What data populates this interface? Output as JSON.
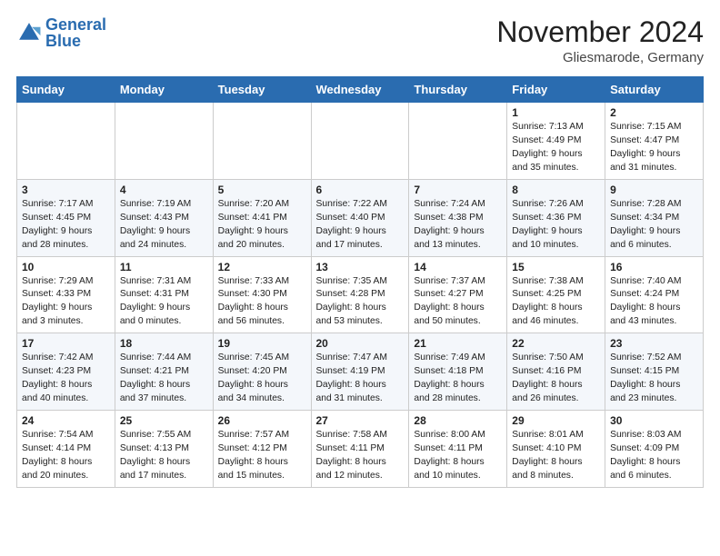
{
  "header": {
    "logo_line1": "General",
    "logo_line2": "Blue",
    "month_title": "November 2024",
    "location": "Gliesmarode, Germany"
  },
  "days_of_week": [
    "Sunday",
    "Monday",
    "Tuesday",
    "Wednesday",
    "Thursday",
    "Friday",
    "Saturday"
  ],
  "weeks": [
    [
      {
        "day": "",
        "info": ""
      },
      {
        "day": "",
        "info": ""
      },
      {
        "day": "",
        "info": ""
      },
      {
        "day": "",
        "info": ""
      },
      {
        "day": "",
        "info": ""
      },
      {
        "day": "1",
        "info": "Sunrise: 7:13 AM\nSunset: 4:49 PM\nDaylight: 9 hours and 35 minutes."
      },
      {
        "day": "2",
        "info": "Sunrise: 7:15 AM\nSunset: 4:47 PM\nDaylight: 9 hours and 31 minutes."
      }
    ],
    [
      {
        "day": "3",
        "info": "Sunrise: 7:17 AM\nSunset: 4:45 PM\nDaylight: 9 hours and 28 minutes."
      },
      {
        "day": "4",
        "info": "Sunrise: 7:19 AM\nSunset: 4:43 PM\nDaylight: 9 hours and 24 minutes."
      },
      {
        "day": "5",
        "info": "Sunrise: 7:20 AM\nSunset: 4:41 PM\nDaylight: 9 hours and 20 minutes."
      },
      {
        "day": "6",
        "info": "Sunrise: 7:22 AM\nSunset: 4:40 PM\nDaylight: 9 hours and 17 minutes."
      },
      {
        "day": "7",
        "info": "Sunrise: 7:24 AM\nSunset: 4:38 PM\nDaylight: 9 hours and 13 minutes."
      },
      {
        "day": "8",
        "info": "Sunrise: 7:26 AM\nSunset: 4:36 PM\nDaylight: 9 hours and 10 minutes."
      },
      {
        "day": "9",
        "info": "Sunrise: 7:28 AM\nSunset: 4:34 PM\nDaylight: 9 hours and 6 minutes."
      }
    ],
    [
      {
        "day": "10",
        "info": "Sunrise: 7:29 AM\nSunset: 4:33 PM\nDaylight: 9 hours and 3 minutes."
      },
      {
        "day": "11",
        "info": "Sunrise: 7:31 AM\nSunset: 4:31 PM\nDaylight: 9 hours and 0 minutes."
      },
      {
        "day": "12",
        "info": "Sunrise: 7:33 AM\nSunset: 4:30 PM\nDaylight: 8 hours and 56 minutes."
      },
      {
        "day": "13",
        "info": "Sunrise: 7:35 AM\nSunset: 4:28 PM\nDaylight: 8 hours and 53 minutes."
      },
      {
        "day": "14",
        "info": "Sunrise: 7:37 AM\nSunset: 4:27 PM\nDaylight: 8 hours and 50 minutes."
      },
      {
        "day": "15",
        "info": "Sunrise: 7:38 AM\nSunset: 4:25 PM\nDaylight: 8 hours and 46 minutes."
      },
      {
        "day": "16",
        "info": "Sunrise: 7:40 AM\nSunset: 4:24 PM\nDaylight: 8 hours and 43 minutes."
      }
    ],
    [
      {
        "day": "17",
        "info": "Sunrise: 7:42 AM\nSunset: 4:23 PM\nDaylight: 8 hours and 40 minutes."
      },
      {
        "day": "18",
        "info": "Sunrise: 7:44 AM\nSunset: 4:21 PM\nDaylight: 8 hours and 37 minutes."
      },
      {
        "day": "19",
        "info": "Sunrise: 7:45 AM\nSunset: 4:20 PM\nDaylight: 8 hours and 34 minutes."
      },
      {
        "day": "20",
        "info": "Sunrise: 7:47 AM\nSunset: 4:19 PM\nDaylight: 8 hours and 31 minutes."
      },
      {
        "day": "21",
        "info": "Sunrise: 7:49 AM\nSunset: 4:18 PM\nDaylight: 8 hours and 28 minutes."
      },
      {
        "day": "22",
        "info": "Sunrise: 7:50 AM\nSunset: 4:16 PM\nDaylight: 8 hours and 26 minutes."
      },
      {
        "day": "23",
        "info": "Sunrise: 7:52 AM\nSunset: 4:15 PM\nDaylight: 8 hours and 23 minutes."
      }
    ],
    [
      {
        "day": "24",
        "info": "Sunrise: 7:54 AM\nSunset: 4:14 PM\nDaylight: 8 hours and 20 minutes."
      },
      {
        "day": "25",
        "info": "Sunrise: 7:55 AM\nSunset: 4:13 PM\nDaylight: 8 hours and 17 minutes."
      },
      {
        "day": "26",
        "info": "Sunrise: 7:57 AM\nSunset: 4:12 PM\nDaylight: 8 hours and 15 minutes."
      },
      {
        "day": "27",
        "info": "Sunrise: 7:58 AM\nSunset: 4:11 PM\nDaylight: 8 hours and 12 minutes."
      },
      {
        "day": "28",
        "info": "Sunrise: 8:00 AM\nSunset: 4:11 PM\nDaylight: 8 hours and 10 minutes."
      },
      {
        "day": "29",
        "info": "Sunrise: 8:01 AM\nSunset: 4:10 PM\nDaylight: 8 hours and 8 minutes."
      },
      {
        "day": "30",
        "info": "Sunrise: 8:03 AM\nSunset: 4:09 PM\nDaylight: 8 hours and 6 minutes."
      }
    ]
  ]
}
